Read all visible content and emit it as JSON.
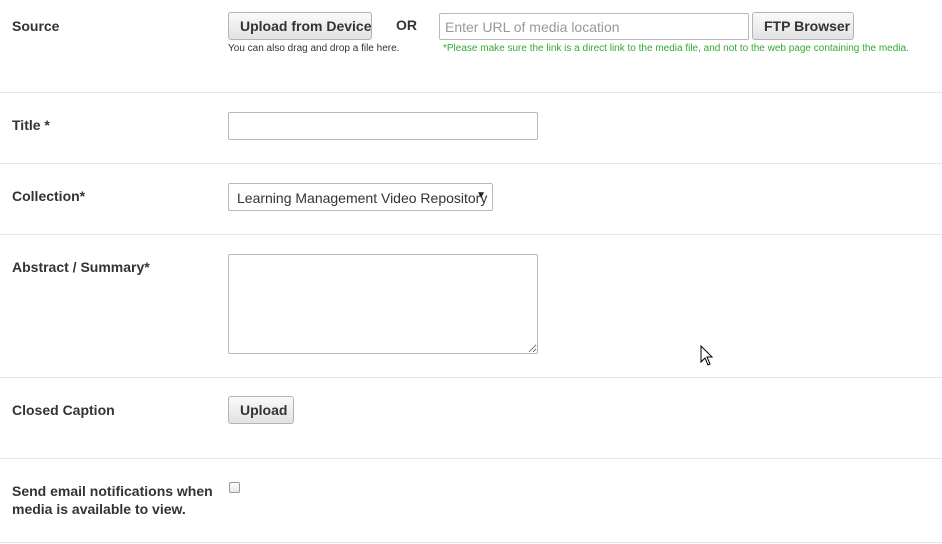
{
  "source": {
    "label": "Source",
    "upload_button": "Upload from Device",
    "drag_hint": "You can also drag and drop a file here.",
    "or_text": "OR",
    "url_placeholder": "Enter URL of media location",
    "ftp_button": "FTP Browser",
    "url_note": "*Please make sure the link is a direct link to the media file, and not to the web page containing the media."
  },
  "title": {
    "label": "Title *",
    "value": ""
  },
  "collection": {
    "label": "Collection*",
    "selected": "Learning Management Video Repository"
  },
  "abstract": {
    "label": "Abstract / Summary*",
    "value": ""
  },
  "closed_caption": {
    "label": "Closed Caption",
    "upload_button": "Upload"
  },
  "notifications": {
    "label_line1": "Send email notifications when",
    "label_line2": "media is available to view.",
    "checked": false
  },
  "colors": {
    "note_green": "#33aa33",
    "label_text": "#333333",
    "divider": "#e6e6e6"
  },
  "icons": [
    "select-caret-icon",
    "textarea-resize-icon",
    "mouse-cursor-icon"
  ]
}
